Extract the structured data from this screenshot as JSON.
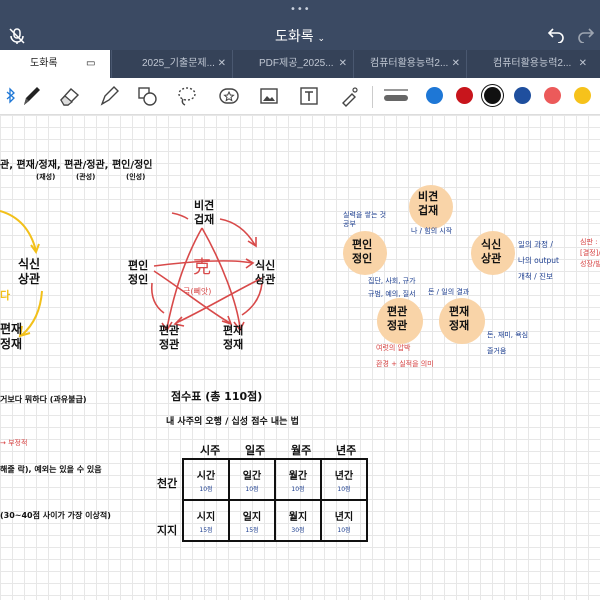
{
  "app": {
    "notebook_title": "도화록",
    "tabs": [
      {
        "label": "도화록",
        "active": true
      },
      {
        "label": "2025_기출문제...",
        "active": false
      },
      {
        "label": "PDF제공_2025...",
        "active": false
      },
      {
        "label": "컴퓨터활용능력2...",
        "active": false
      },
      {
        "label": "컴퓨터활용능력2...",
        "active": false
      }
    ]
  },
  "toolbar": {
    "tools": [
      "bluetooth-icon",
      "pen-icon",
      "eraser-icon",
      "highlighter-icon",
      "shapes-icon",
      "lasso-icon",
      "sticker-icon",
      "image-icon",
      "text-icon",
      "laser-icon"
    ],
    "colors": [
      "#1e77d6",
      "#c8151c",
      "#111111",
      "#1f4f9e",
      "#ec5a5a",
      "#f6c21b"
    ],
    "selected_color": "#111111"
  },
  "note": {
    "top_left_line": "관, 편재/정재, 편관/정관, 편인/정인",
    "top_sub": [
      "(재성)",
      "(관성)",
      "(인성)"
    ],
    "left_yellow": [
      "식신",
      "상관"
    ],
    "left_yellow_partial": "다",
    "left_black": [
      "편재",
      "정재"
    ],
    "pentagon": {
      "top": [
        "비견",
        "겁재"
      ],
      "right": [
        "식신",
        "상관"
      ],
      "bottom_right": [
        "편재",
        "정재"
      ],
      "bottom_left": [
        "편관",
        "정관"
      ],
      "left": [
        "편인",
        "정인"
      ],
      "center_char": "克",
      "center_note": "극(뻬앗)"
    },
    "orange_nodes": {
      "top": [
        "비견",
        "겁재"
      ],
      "left": [
        "편인",
        "정인"
      ],
      "right": [
        "식신",
        "상관"
      ],
      "bottom_left": [
        "편관",
        "정관"
      ],
      "bottom_right": [
        "편재",
        "정재"
      ]
    },
    "annotations": {
      "near_inseong": [
        "실력을 쌓는 것",
        "공부"
      ],
      "near_bigyeon": "나 / 힘의 시작",
      "near_siksin": [
        "일의 과정 /",
        "나의 output",
        "개척 / 진보"
      ],
      "far_right": [
        "심판 :",
        "[결정]/[결",
        "성장/발전"
      ],
      "near_gwan": [
        "집단, 사회, 규가",
        "규범, 예의, 질서"
      ],
      "near_jae": "돈 / 일의 결과",
      "jae_sub": [
        "돈, 재미, 욕심",
        "즐거움"
      ],
      "gwan_red": [
        "여럿의 압박",
        "환경 + 실적을 의미"
      ]
    },
    "left_lines": [
      "거보다 뭐하다 (과유불급)",
      "→ 부정적",
      "해줄 락), 예외는 있을 수 있음",
      "(30~40점 사이가 가장 이상적)"
    ],
    "score_title": "점수표 (총 110점)",
    "score_subtitle": "내 사주의 오행 / 십성 점수 내는 법",
    "table": {
      "columns": [
        "시주",
        "일주",
        "월주",
        "년주"
      ],
      "rows": [
        {
          "label": "천간",
          "cells": [
            {
              "name": "시간",
              "score": "10점"
            },
            {
              "name": "일간",
              "score": "10점"
            },
            {
              "name": "월간",
              "score": "10점"
            },
            {
              "name": "년간",
              "score": "10점"
            }
          ]
        },
        {
          "label": "지지",
          "cells": [
            {
              "name": "시지",
              "score": "15점"
            },
            {
              "name": "일지",
              "score": "15점"
            },
            {
              "name": "월지",
              "score": "30점"
            },
            {
              "name": "년지",
              "score": "10점"
            }
          ]
        }
      ]
    }
  }
}
